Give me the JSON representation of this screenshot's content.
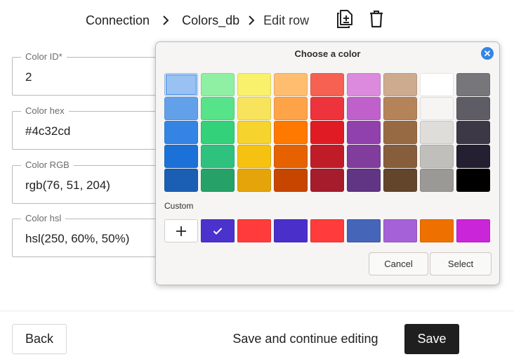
{
  "breadcrumb": {
    "items": [
      "Connection",
      "Colors_db"
    ],
    "current": "Edit row"
  },
  "header_icons": [
    "add-document-icon",
    "trash-icon"
  ],
  "form": {
    "fields": [
      {
        "label": "Color ID*",
        "value": "2"
      },
      {
        "label": "Color hex",
        "value": "#4c32cd"
      },
      {
        "label": "Color RGB",
        "value": "rgb(76, 51, 204)"
      },
      {
        "label": "Color hsl",
        "value": "hsl(250, 60%, 50%)"
      }
    ]
  },
  "footer": {
    "back_label": "Back",
    "continue_label": "Save and continue editing",
    "save_label": "Save"
  },
  "color_dialog": {
    "title": "Choose a color",
    "custom_label": "Custom",
    "cancel_label": "Cancel",
    "select_label": "Select",
    "palette": [
      [
        "#99c1f1",
        "#8ff0a4",
        "#f9f06b",
        "#ffbe6f",
        "#f66151",
        "#dc8add",
        "#cdab8f",
        "#ffffff",
        "#77767b"
      ],
      [
        "#62a0ea",
        "#57e389",
        "#f8e45c",
        "#ffa348",
        "#ed333b",
        "#c061cb",
        "#b5835a",
        "#f6f5f4",
        "#5e5c64"
      ],
      [
        "#3584e4",
        "#33d17a",
        "#f6d32d",
        "#ff7800",
        "#e01b24",
        "#9141ac",
        "#986a44",
        "#deddda",
        "#3d3846"
      ],
      [
        "#1c71d8",
        "#2ec27e",
        "#f5c211",
        "#e66100",
        "#c01c28",
        "#813d9c",
        "#865e3c",
        "#c0bfbc",
        "#241f31"
      ],
      [
        "#1a5fb4",
        "#26a269",
        "#e5a50a",
        "#c64600",
        "#a51d2d",
        "#613583",
        "#63452c",
        "#9a9996",
        "#000000"
      ]
    ],
    "selected_swatch": {
      "row": 0,
      "col": 0
    },
    "custom_colors": [
      "#4c32cd",
      "#ff3b3b",
      "#4a2fcb",
      "#ff3b3b",
      "#4566b8",
      "#a561d8",
      "#ee7100",
      "#ca25d8"
    ],
    "custom_selected_index": 0,
    "accent": "#3584e4"
  }
}
